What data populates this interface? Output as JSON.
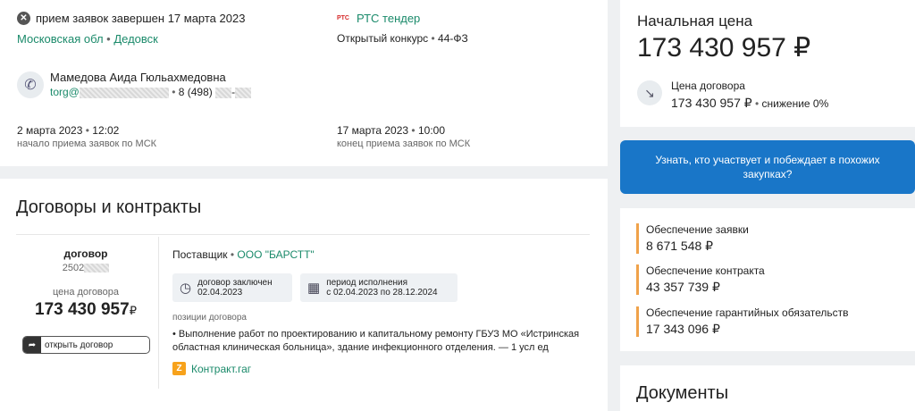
{
  "summary": {
    "status": "прием заявок завершен 17 марта 2023",
    "region": "Московская обл",
    "city": "Дедовск",
    "platform_logo": "РТС",
    "platform": "РТС тендер",
    "procedure": "Открытый конкурс",
    "law": "44-ФЗ",
    "contact_name": "Мамедова Аида Гюльахмедовна",
    "contact_email_prefix": "torg@",
    "contact_phone_prefix": "8 (498)",
    "start_date": "2 марта 2023",
    "start_time": "12:02",
    "start_label": "начало приема заявок по МСК",
    "end_date": "17 марта 2023",
    "end_time": "10:00",
    "end_label": "конец приема заявок по МСК"
  },
  "contracts": {
    "title": "Договоры и контракты",
    "type": "договор",
    "number_prefix": "2502",
    "price_label": "цена договора",
    "price": "173 430 957",
    "currency": "₽",
    "open_button": "открыть договор",
    "supplier_label": "Поставщик",
    "supplier": "ООО \"БАРСТТ\"",
    "signed_label": "договор заключен",
    "signed_date": "02.04.2023",
    "period_label": "период исполнения",
    "period_value": "с 02.04.2023 по 28.12.2024",
    "positions_label": "позиции договора",
    "position_text": "• Выполнение работ по проектированию и капитальному ремонту ГБУЗ МО «Истринская областная клиническая больница», здание инфекционного отделения. — 1 усл ед",
    "source": "Контракт.гаг"
  },
  "price_card": {
    "label": "Начальная цена",
    "value": "173 430 957 ₽",
    "contract_label": "Цена договора",
    "contract_value": "173 430 957 ₽",
    "reduction": "снижение 0%"
  },
  "cta": {
    "label": "Узнать, кто участвует и побеждает в похожих закупках?"
  },
  "securities": [
    {
      "label": "Обеспечение заявки",
      "value": "8 671 548 ₽"
    },
    {
      "label": "Обеспечение контракта",
      "value": "43 357 739 ₽"
    },
    {
      "label": "Обеспечение гарантийных обязательств",
      "value": "17 343 096 ₽"
    }
  ],
  "documents": {
    "title": "Документы"
  },
  "colors": {
    "accent_green": "#1a8a6a",
    "button_blue": "#1976c8",
    "security_bar": "#f0a24a"
  }
}
